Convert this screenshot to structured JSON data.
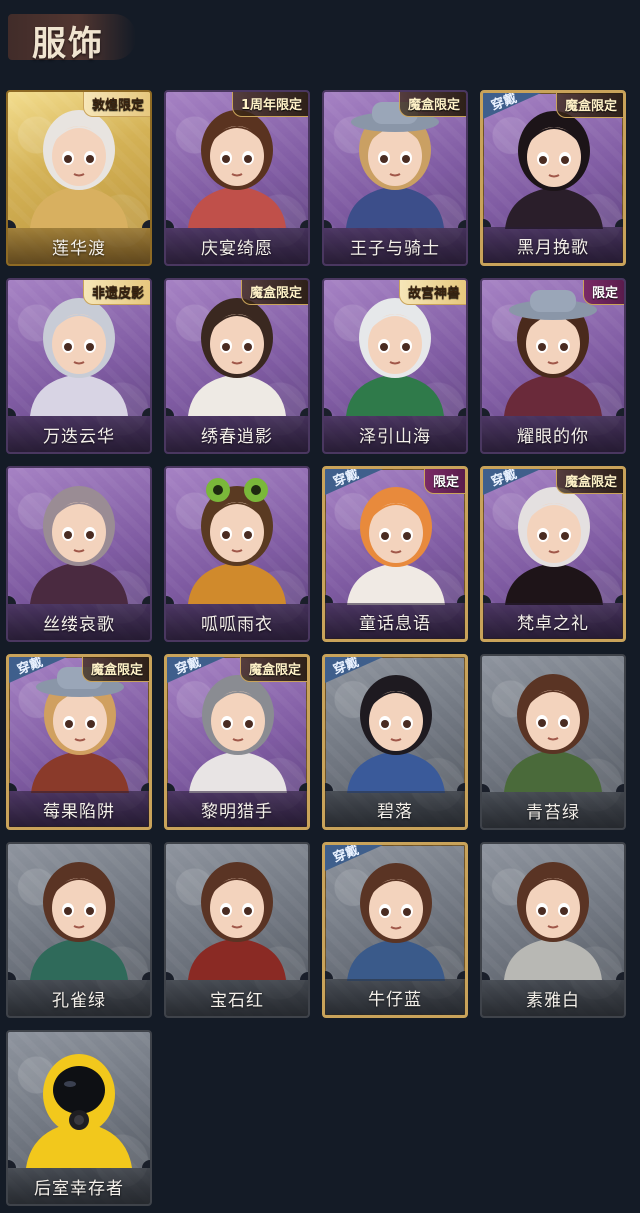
{
  "header": {
    "title": "服饰"
  },
  "colors": {
    "background": "#141b26",
    "gold": "#c9a35a",
    "purple": "#7f5ba2",
    "gray": "#6d737d",
    "worn_badge": "#3f5f8c"
  },
  "worn_label": "穿戴",
  "costumes": [
    {
      "name": "莲华渡",
      "tag": "敦煌限定",
      "rarity": "gold",
      "worn": false,
      "avatar": "female-white-hair-masked"
    },
    {
      "name": "庆宴绮愿",
      "tag": "1周年限定",
      "rarity": "purple",
      "worn": false,
      "avatar": "female-birthday-cake"
    },
    {
      "name": "王子与骑士",
      "tag": "魔盒限定",
      "rarity": "purple",
      "worn": false,
      "avatar": "male-knight-hat"
    },
    {
      "name": "黑月挽歌",
      "tag": "魔盒限定",
      "rarity": "purple",
      "worn": true,
      "avatar": "female-black-hair"
    },
    {
      "name": "万迭云华",
      "tag": "非遗皮影",
      "rarity": "purple",
      "worn": false,
      "avatar": "male-silver-long-hair"
    },
    {
      "name": "绣春逍影",
      "tag": "魔盒限定",
      "rarity": "purple",
      "worn": false,
      "avatar": "male-brown-hair-headband"
    },
    {
      "name": "泽引山海",
      "tag": "故宫神兽",
      "rarity": "purple",
      "worn": false,
      "avatar": "male-white-hair-green"
    },
    {
      "name": "耀眼的你",
      "tag": "限定",
      "rarity": "purple",
      "worn": false,
      "avatar": "female-cowboy-hat"
    },
    {
      "name": "丝缕哀歌",
      "tag": "",
      "rarity": "purple",
      "worn": false,
      "avatar": "female-grey-hair-lace"
    },
    {
      "name": "呱呱雨衣",
      "tag": "",
      "rarity": "purple",
      "worn": false,
      "avatar": "female-frog-hood"
    },
    {
      "name": "童话息语",
      "tag": "限定",
      "rarity": "purple",
      "worn": true,
      "avatar": "female-orange-hair"
    },
    {
      "name": "梵卓之礼",
      "tag": "魔盒限定",
      "rarity": "purple",
      "worn": true,
      "avatar": "male-vampire-white-hair"
    },
    {
      "name": "莓果陷阱",
      "tag": "魔盒限定",
      "rarity": "purple",
      "worn": true,
      "avatar": "female-strawberry-hat"
    },
    {
      "name": "黎明猎手",
      "tag": "魔盒限定",
      "rarity": "purple",
      "worn": true,
      "avatar": "male-silver-black-hair"
    },
    {
      "name": "碧落",
      "tag": "",
      "rarity": "gray",
      "worn": true,
      "avatar": "male-dark-hair-blue"
    },
    {
      "name": "青苔绿",
      "tag": "",
      "rarity": "gray",
      "worn": false,
      "avatar": "female-green-cloak"
    },
    {
      "name": "孔雀绿",
      "tag": "",
      "rarity": "gray",
      "worn": false,
      "avatar": "female-teal-cloak"
    },
    {
      "name": "宝石红",
      "tag": "",
      "rarity": "gray",
      "worn": false,
      "avatar": "female-red-cloak"
    },
    {
      "name": "牛仔蓝",
      "tag": "",
      "rarity": "gray",
      "worn": true,
      "avatar": "female-blue-cloak"
    },
    {
      "name": "素雅白",
      "tag": "",
      "rarity": "gray",
      "worn": false,
      "avatar": "female-white-cloak"
    },
    {
      "name": "后室幸存者",
      "tag": "",
      "rarity": "gray",
      "worn": false,
      "avatar": "hazmat-yellow-gasmask"
    }
  ]
}
